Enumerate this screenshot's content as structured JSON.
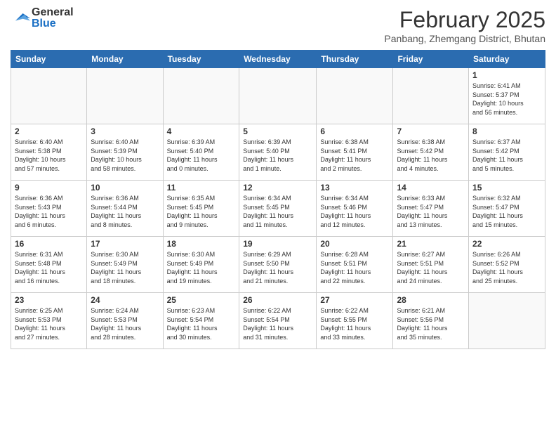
{
  "header": {
    "logo_general": "General",
    "logo_blue": "Blue",
    "month_title": "February 2025",
    "location": "Panbang, Zhemgang District, Bhutan"
  },
  "days_of_week": [
    "Sunday",
    "Monday",
    "Tuesday",
    "Wednesday",
    "Thursday",
    "Friday",
    "Saturday"
  ],
  "weeks": [
    [
      {
        "day": "",
        "info": ""
      },
      {
        "day": "",
        "info": ""
      },
      {
        "day": "",
        "info": ""
      },
      {
        "day": "",
        "info": ""
      },
      {
        "day": "",
        "info": ""
      },
      {
        "day": "",
        "info": ""
      },
      {
        "day": "1",
        "info": "Sunrise: 6:41 AM\nSunset: 5:37 PM\nDaylight: 10 hours\nand 56 minutes."
      }
    ],
    [
      {
        "day": "2",
        "info": "Sunrise: 6:40 AM\nSunset: 5:38 PM\nDaylight: 10 hours\nand 57 minutes."
      },
      {
        "day": "3",
        "info": "Sunrise: 6:40 AM\nSunset: 5:39 PM\nDaylight: 10 hours\nand 58 minutes."
      },
      {
        "day": "4",
        "info": "Sunrise: 6:39 AM\nSunset: 5:40 PM\nDaylight: 11 hours\nand 0 minutes."
      },
      {
        "day": "5",
        "info": "Sunrise: 6:39 AM\nSunset: 5:40 PM\nDaylight: 11 hours\nand 1 minute."
      },
      {
        "day": "6",
        "info": "Sunrise: 6:38 AM\nSunset: 5:41 PM\nDaylight: 11 hours\nand 2 minutes."
      },
      {
        "day": "7",
        "info": "Sunrise: 6:38 AM\nSunset: 5:42 PM\nDaylight: 11 hours\nand 4 minutes."
      },
      {
        "day": "8",
        "info": "Sunrise: 6:37 AM\nSunset: 5:42 PM\nDaylight: 11 hours\nand 5 minutes."
      }
    ],
    [
      {
        "day": "9",
        "info": "Sunrise: 6:36 AM\nSunset: 5:43 PM\nDaylight: 11 hours\nand 6 minutes."
      },
      {
        "day": "10",
        "info": "Sunrise: 6:36 AM\nSunset: 5:44 PM\nDaylight: 11 hours\nand 8 minutes."
      },
      {
        "day": "11",
        "info": "Sunrise: 6:35 AM\nSunset: 5:45 PM\nDaylight: 11 hours\nand 9 minutes."
      },
      {
        "day": "12",
        "info": "Sunrise: 6:34 AM\nSunset: 5:45 PM\nDaylight: 11 hours\nand 11 minutes."
      },
      {
        "day": "13",
        "info": "Sunrise: 6:34 AM\nSunset: 5:46 PM\nDaylight: 11 hours\nand 12 minutes."
      },
      {
        "day": "14",
        "info": "Sunrise: 6:33 AM\nSunset: 5:47 PM\nDaylight: 11 hours\nand 13 minutes."
      },
      {
        "day": "15",
        "info": "Sunrise: 6:32 AM\nSunset: 5:47 PM\nDaylight: 11 hours\nand 15 minutes."
      }
    ],
    [
      {
        "day": "16",
        "info": "Sunrise: 6:31 AM\nSunset: 5:48 PM\nDaylight: 11 hours\nand 16 minutes."
      },
      {
        "day": "17",
        "info": "Sunrise: 6:30 AM\nSunset: 5:49 PM\nDaylight: 11 hours\nand 18 minutes."
      },
      {
        "day": "18",
        "info": "Sunrise: 6:30 AM\nSunset: 5:49 PM\nDaylight: 11 hours\nand 19 minutes."
      },
      {
        "day": "19",
        "info": "Sunrise: 6:29 AM\nSunset: 5:50 PM\nDaylight: 11 hours\nand 21 minutes."
      },
      {
        "day": "20",
        "info": "Sunrise: 6:28 AM\nSunset: 5:51 PM\nDaylight: 11 hours\nand 22 minutes."
      },
      {
        "day": "21",
        "info": "Sunrise: 6:27 AM\nSunset: 5:51 PM\nDaylight: 11 hours\nand 24 minutes."
      },
      {
        "day": "22",
        "info": "Sunrise: 6:26 AM\nSunset: 5:52 PM\nDaylight: 11 hours\nand 25 minutes."
      }
    ],
    [
      {
        "day": "23",
        "info": "Sunrise: 6:25 AM\nSunset: 5:53 PM\nDaylight: 11 hours\nand 27 minutes."
      },
      {
        "day": "24",
        "info": "Sunrise: 6:24 AM\nSunset: 5:53 PM\nDaylight: 11 hours\nand 28 minutes."
      },
      {
        "day": "25",
        "info": "Sunrise: 6:23 AM\nSunset: 5:54 PM\nDaylight: 11 hours\nand 30 minutes."
      },
      {
        "day": "26",
        "info": "Sunrise: 6:22 AM\nSunset: 5:54 PM\nDaylight: 11 hours\nand 31 minutes."
      },
      {
        "day": "27",
        "info": "Sunrise: 6:22 AM\nSunset: 5:55 PM\nDaylight: 11 hours\nand 33 minutes."
      },
      {
        "day": "28",
        "info": "Sunrise: 6:21 AM\nSunset: 5:56 PM\nDaylight: 11 hours\nand 35 minutes."
      },
      {
        "day": "",
        "info": ""
      }
    ]
  ]
}
